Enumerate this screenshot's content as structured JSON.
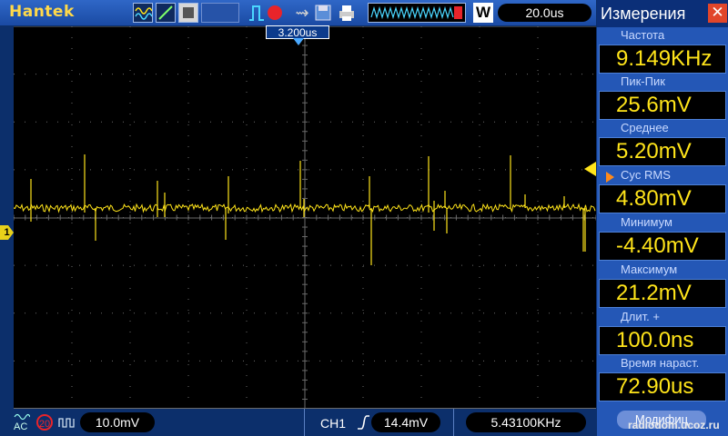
{
  "brand": "Hantek",
  "timebase": "20.0us",
  "memory_label": "W",
  "trigger_position": "3.200us",
  "channel_marker": "1",
  "panel": {
    "title": "Измерения",
    "measurements": [
      {
        "label": "Частота",
        "value": "9.149KHz"
      },
      {
        "label": "Пик-Пик",
        "value": "25.6mV"
      },
      {
        "label": "Среднее",
        "value": "5.20mV"
      },
      {
        "label": "Cyc  RMS",
        "value": "4.80mV"
      },
      {
        "label": "Минимум",
        "value": "-4.40mV"
      },
      {
        "label": "Максимум",
        "value": "21.2mV"
      },
      {
        "label": "Длит.  +",
        "value": "100.0ns"
      },
      {
        "label": "Время  нараст.",
        "value": "72.90us"
      }
    ],
    "modify_button": "Модифиц",
    "selected_index": 3
  },
  "bottom": {
    "coupling": "AC",
    "bw_limit": "20",
    "volts_div": "10.0mV",
    "channel": "CH1",
    "trigger_level": "14.4mV",
    "trigger_freq": "5.43100KHz"
  },
  "watermark": "radiodom.ucoz.ru",
  "colors": {
    "trace": "#ffe41a",
    "grid": "#6b6b6b",
    "panel_bg": "#2457b6",
    "value_text": "#ffe41a"
  }
}
